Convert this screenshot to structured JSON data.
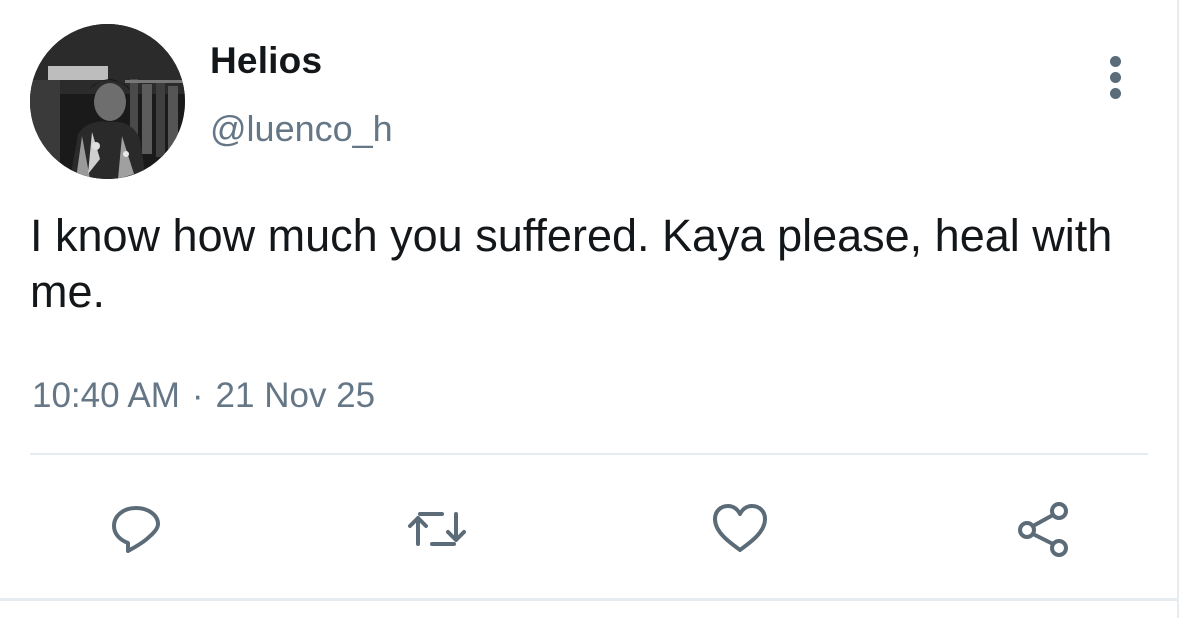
{
  "user": {
    "display_name": "Helios",
    "handle": "@luenco_h",
    "avatar_icon": "profile-photo"
  },
  "tweet": {
    "text": "I know how much you suffered. Kaya please, heal with me.",
    "time": "10:40 AM",
    "separator": "·",
    "date": "21 Nov 25"
  },
  "actions": [
    {
      "name": "reply",
      "icon": "speech-bubble-icon"
    },
    {
      "name": "retweet",
      "icon": "retweet-icon"
    },
    {
      "name": "like",
      "icon": "heart-icon"
    },
    {
      "name": "share",
      "icon": "share-icon"
    }
  ],
  "more_icon": "vertical-ellipsis-icon",
  "colors": {
    "text_primary": "#14171a",
    "text_secondary": "#657786",
    "icon": "#5b6b78",
    "divider": "#e6ecf0"
  }
}
